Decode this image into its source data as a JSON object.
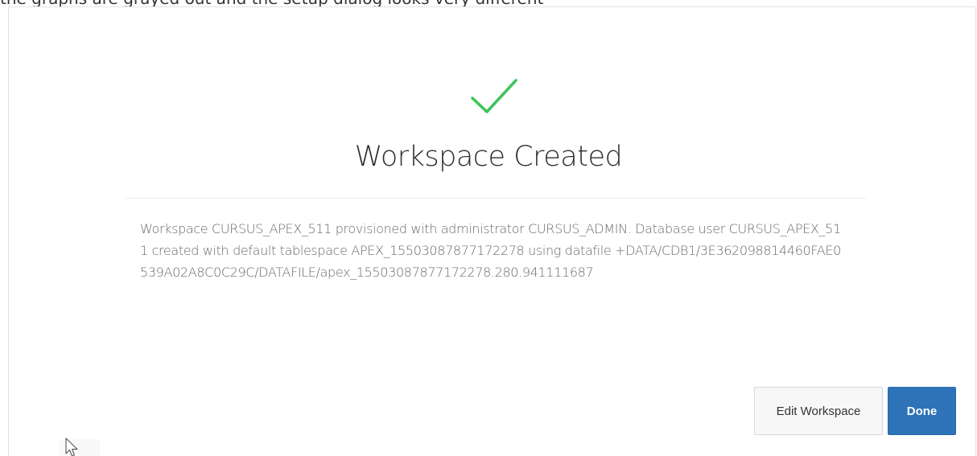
{
  "header": {
    "cut_text": "the graphs are grayed out and the setup dialog looks very different"
  },
  "dialog": {
    "title": "Workspace Created",
    "message": "Workspace CURSUS_APEX_511 provisioned with administrator CURSUS_ADMIN. Database user CURSUS_APEX_511 created with default tablespace APEX_15503087877172278 using datafile +DATA/CDB1/3E362098814460FAE0539A02A8C0C29C/DATAFILE/apex_15503087877172278.280.941111687",
    "success_icon": "check-icon",
    "success_color": "#3ec45a"
  },
  "buttons": {
    "edit_label": "Edit Workspace",
    "done_label": "Done",
    "primary_color": "#2e73b8"
  },
  "cursor": {
    "icon": "mouse-pointer-icon"
  }
}
